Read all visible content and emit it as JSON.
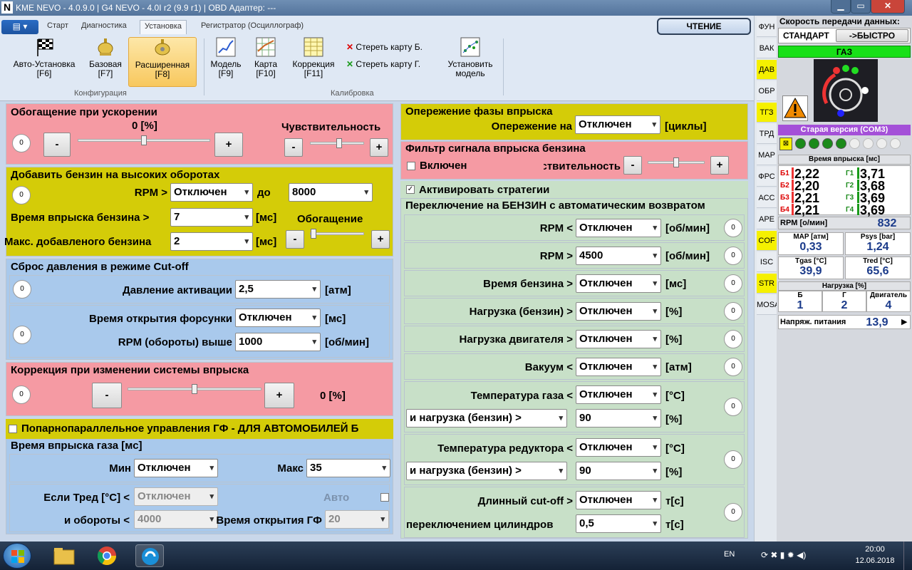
{
  "window": {
    "title": "KME NEVO - 4.0.9.0  |  G4 NEVO - 4.0I r2 (9.9 r1)  |  OBD Адаптер: ---"
  },
  "ribbon": {
    "tabs": [
      "Старт",
      "Диагностика",
      "Установка",
      "Регистратор (Осциллограф)"
    ],
    "read_button": "ЧТЕНИЕ",
    "buttons": [
      {
        "label": "Авто-Установка",
        "key": "[F6]"
      },
      {
        "label": "Базовая",
        "key": "[F7]"
      },
      {
        "label": "Расширенная",
        "key": "[F8]"
      },
      {
        "label": "Модель",
        "key": "[F9]"
      },
      {
        "label": "Карта",
        "key": "[F10]"
      },
      {
        "label": "Коррекция",
        "key": "[F11]"
      }
    ],
    "erase_b": "Стереть карту Б.",
    "erase_g": "Стереть карту Г.",
    "set_model": [
      "Установить",
      "модель"
    ],
    "group_config": "Конфигурация",
    "group_calib": "Калибровка"
  },
  "accel": {
    "title": "Обогащение при ускорении",
    "circle": "0",
    "value": "0  [%]",
    "sens_label": "Чувствительность",
    "minus": "-",
    "plus": "+",
    "slider": 0.5,
    "sens_slider": 0.55
  },
  "highrpm": {
    "title": "Добавить бензин на высоких оборотах",
    "circle": "0",
    "rpm_label": "RPM >",
    "rpm_val": "Отключен",
    "to": "до",
    "to_val": "8000",
    "time_label": "Время впрыска бензина >",
    "time_val": "7",
    "ms": "[мс]",
    "max_label": "Макс. добавленого бензина",
    "max_val": "2",
    "enrich": "Обогащение",
    "slider": 0.02
  },
  "cutoff": {
    "title": "Сброс давления в режиме Cut-off",
    "c1": "0",
    "c2": "0",
    "press_label": "Давление активации",
    "press_val": "2,5",
    "press_unit": "[атм]",
    "open_label": "Время открытия форсунки",
    "open_val": "Отключен",
    "open_unit": "[мс]",
    "rpm_label": "RPM (обороты) выше",
    "rpm_val": "1000",
    "rpm_unit": "[об/мин]"
  },
  "corr": {
    "title": "Коррекция при изменении системы впрыска",
    "circle": "0",
    "value": "0  [%]",
    "slider": 0.5
  },
  "seq": {
    "label": "Попарнопараллельное управления ГФ - ДЛЯ АВТОМОБИЛЕЙ Б"
  },
  "gasinj": {
    "title": "Время впрыска газа [мс]",
    "min_label": "Мин",
    "min_val": "Отключен",
    "max_label": "Макс",
    "max_val": "35",
    "tred_label": "Если Тред [°C] <",
    "tred_val": "Отключен",
    "auto": "Авто",
    "rpm_label": "и обороты <",
    "rpm_val": "4000",
    "open_label": "Время открытия ГФ",
    "open_val": "20"
  },
  "advance": {
    "title": "Опережение фазы впрыска",
    "label": "Опережение на",
    "val": "Отключен",
    "unit": "[циклы]"
  },
  "filter": {
    "title": "Фильтр сигнала впрыска бензина",
    "enabled": "Включен",
    "sens": "Чувствительность:",
    "slider": 0.5
  },
  "strat": {
    "label": "Активировать стратегии"
  },
  "switch": {
    "title": "Переключение на БЕНЗИН с автоматическим возвратом",
    "rows": [
      {
        "label": "RPM <",
        "val": "Отключен",
        "unit": "[об/мин]",
        "circle": "0"
      },
      {
        "label": "RPM >",
        "val": "4500",
        "unit": "[об/мин]",
        "circle": "0"
      },
      {
        "label": "Время бензина >",
        "val": "Отключен",
        "unit": "[мс]",
        "circle": "0"
      },
      {
        "label": "Нагрузка (бензин) >",
        "val": "Отключен",
        "unit": "[%]",
        "circle": "0"
      },
      {
        "label": "Нагрузка двигателя >",
        "val": "Отключен",
        "unit": "[%]",
        "circle": "0"
      },
      {
        "label": "Вакуум <",
        "val": "Отключен",
        "unit": "[атм]",
        "circle": "0"
      }
    ],
    "gas_temp": {
      "label": "Температура газа <",
      "val": "Отключен",
      "unit": "[°C]",
      "sub": "и нагрузка (бензин) >",
      "sub_val": "90",
      "sub_unit": "[%]",
      "circle": "0"
    },
    "red_temp": {
      "label": "Температура редуктора <",
      "val": "Отключен",
      "unit": "[°C]",
      "sub": "и нагрузка (бензин) >",
      "sub_val": "90",
      "sub_unit": "[%]",
      "circle": "0"
    },
    "long_cut": {
      "label": "Длинный cut-off >",
      "val": "Отключен",
      "unit": "т[с]",
      "sub": "переключением цилиндров",
      "sub_val": "0,5",
      "sub_unit": "т[с]",
      "circle": "0"
    }
  },
  "vtabs": [
    "ФУН",
    "ВАК",
    "ДАВ",
    "ОБР",
    "ТГЗ",
    "ТРД",
    "МАР",
    "ФРС",
    "АСС",
    "АРЕ",
    "COF",
    "ISC",
    "STR",
    "MOSA"
  ],
  "right": {
    "speed_title": "Скорость передачи данных:",
    "std": "СТАНДАРТ",
    "fast": "->БЫСТРО",
    "gas": "ГАЗ",
    "old_ver": "Старая версия (COM3)",
    "inj_title": "Время впрыска [мс]",
    "b_labels": [
      "Б1",
      "Б2",
      "Б3",
      "Б4"
    ],
    "b_vals": [
      "2,22",
      "2,20",
      "2,21",
      "2,21"
    ],
    "g_labels": [
      "Г1",
      "Г2",
      "Г3",
      "Г4"
    ],
    "g_vals": [
      "3,71",
      "3,68",
      "3,69",
      "3,69"
    ],
    "rpm_label": "RPM [о/мин]",
    "rpm_val": "832",
    "map_label": "MAP [атм]",
    "map_val": "0,33",
    "psys_label": "Psys [bar]",
    "psys_val": "1,24",
    "tgas_label": "Tgas [°C]",
    "tgas_val": "39,9",
    "tred_label": "Tred [°C]",
    "tred_val": "65,6",
    "load_title": "Нагрузка [%]",
    "load_b": "Б",
    "load_b_val": "1",
    "load_g": "Г",
    "load_g_val": "2",
    "load_e": "Двигатель",
    "load_e_val": "4",
    "volt_label": "Напряж. питания",
    "volt_val": "13,9"
  },
  "taskbar": {
    "lang": "EN",
    "time": "20:00",
    "date": "12.06.2018"
  },
  "colors": {
    "pink": "#f59aa3",
    "yellow": "#d4cc08",
    "blue": "#a9c9ec",
    "green": "#c8e0c8",
    "accent": "#f5f000"
  }
}
